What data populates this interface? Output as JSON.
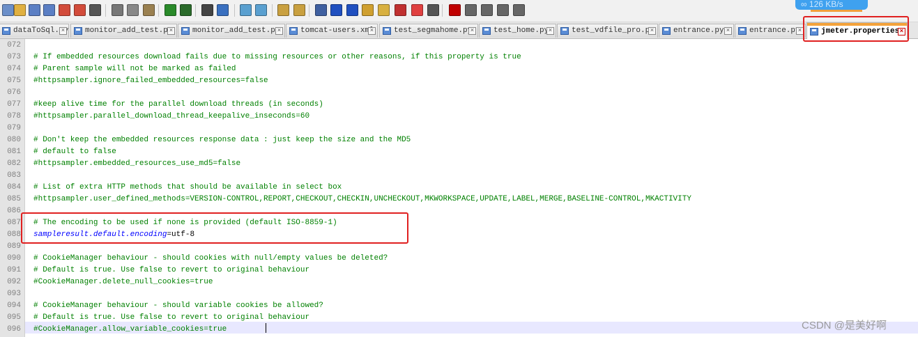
{
  "toolbar": {
    "network_speed": "126 KB/s",
    "icons": [
      "new-file-icon",
      "open-icon",
      "save-icon",
      "save-all-icon",
      "close-icon",
      "close-all-icon",
      "print-icon",
      "cut-icon",
      "copy-icon",
      "paste-icon",
      "undo-icon",
      "redo-icon",
      "find-icon",
      "replace-icon",
      "zoom-in-icon",
      "zoom-out-icon",
      "sync-vertical-icon",
      "sync-horizontal-icon",
      "word-wrap-icon",
      "show-symbols-icon",
      "indent-guide-icon",
      "lang-icon",
      "doc-map-icon",
      "function-list-icon",
      "folder-icon",
      "monitor-icon",
      "record-macro-icon",
      "stop-macro-icon",
      "play-macro-icon",
      "run-macro-icon",
      "save-macro-icon"
    ]
  },
  "tabs": [
    {
      "label": "dataToSql.py"
    },
    {
      "label": "monitor_add_test.py"
    },
    {
      "label": "monitor_add_test.py"
    },
    {
      "label": "tomcat-users.xml"
    },
    {
      "label": "test_segmahome.py"
    },
    {
      "label": "test_home.py"
    },
    {
      "label": "test_vdfile_pro.py"
    },
    {
      "label": "entrance.py"
    },
    {
      "label": "entrance.py"
    },
    {
      "label": "jmeter.properties",
      "active": true
    }
  ],
  "lines": [
    {
      "n": "072",
      "text": ""
    },
    {
      "n": "073",
      "text": "# If embedded resources download fails due to missing resources or other reasons, if this property is true"
    },
    {
      "n": "074",
      "text": "# Parent sample will not be marked as failed"
    },
    {
      "n": "075",
      "text": "#httpsampler.ignore_failed_embedded_resources=false"
    },
    {
      "n": "076",
      "text": ""
    },
    {
      "n": "077",
      "text": "#keep alive time for the parallel download threads (in seconds)"
    },
    {
      "n": "078",
      "text": "#httpsampler.parallel_download_thread_keepalive_inseconds=60"
    },
    {
      "n": "079",
      "text": ""
    },
    {
      "n": "080",
      "text": "# Don't keep the embedded resources response data : just keep the size and the MD5"
    },
    {
      "n": "081",
      "text": "# default to false"
    },
    {
      "n": "082",
      "text": "#httpsampler.embedded_resources_use_md5=false"
    },
    {
      "n": "083",
      "text": ""
    },
    {
      "n": "084",
      "text": "# List of extra HTTP methods that should be available in select box"
    },
    {
      "n": "085",
      "text": "#httpsampler.user_defined_methods=VERSION-CONTROL,REPORT,CHECKOUT,CHECKIN,UNCHECKOUT,MKWORKSPACE,UPDATE,LABEL,MERGE,BASELINE-CONTROL,MKACTIVITY"
    },
    {
      "n": "086",
      "text": ""
    },
    {
      "n": "087",
      "text": "# The encoding to be used if none is provided (default ISO-8859-1)"
    },
    {
      "n": "088",
      "key": "sampleresult.default.encoding",
      "value": "=utf-8"
    },
    {
      "n": "089",
      "text": ""
    },
    {
      "n": "090",
      "text": "# CookieManager behaviour - should cookies with null/empty values be deleted?"
    },
    {
      "n": "091",
      "text": "# Default is true. Use false to revert to original behaviour"
    },
    {
      "n": "092",
      "text": "#CookieManager.delete_null_cookies=true"
    },
    {
      "n": "093",
      "text": ""
    },
    {
      "n": "094",
      "text": "# CookieManager behaviour - should variable cookies be allowed?"
    },
    {
      "n": "095",
      "text": "# Default is true. Use false to revert to original behaviour"
    },
    {
      "n": "096",
      "text": "#CookieManager.allow_variable_cookies=true"
    }
  ],
  "watermark": "CSDN @是美好啊",
  "colors": {
    "comment": "#008000",
    "key": "#0000ff",
    "highlight": "#e02020",
    "active_tab_accent": "#f4a23a"
  }
}
